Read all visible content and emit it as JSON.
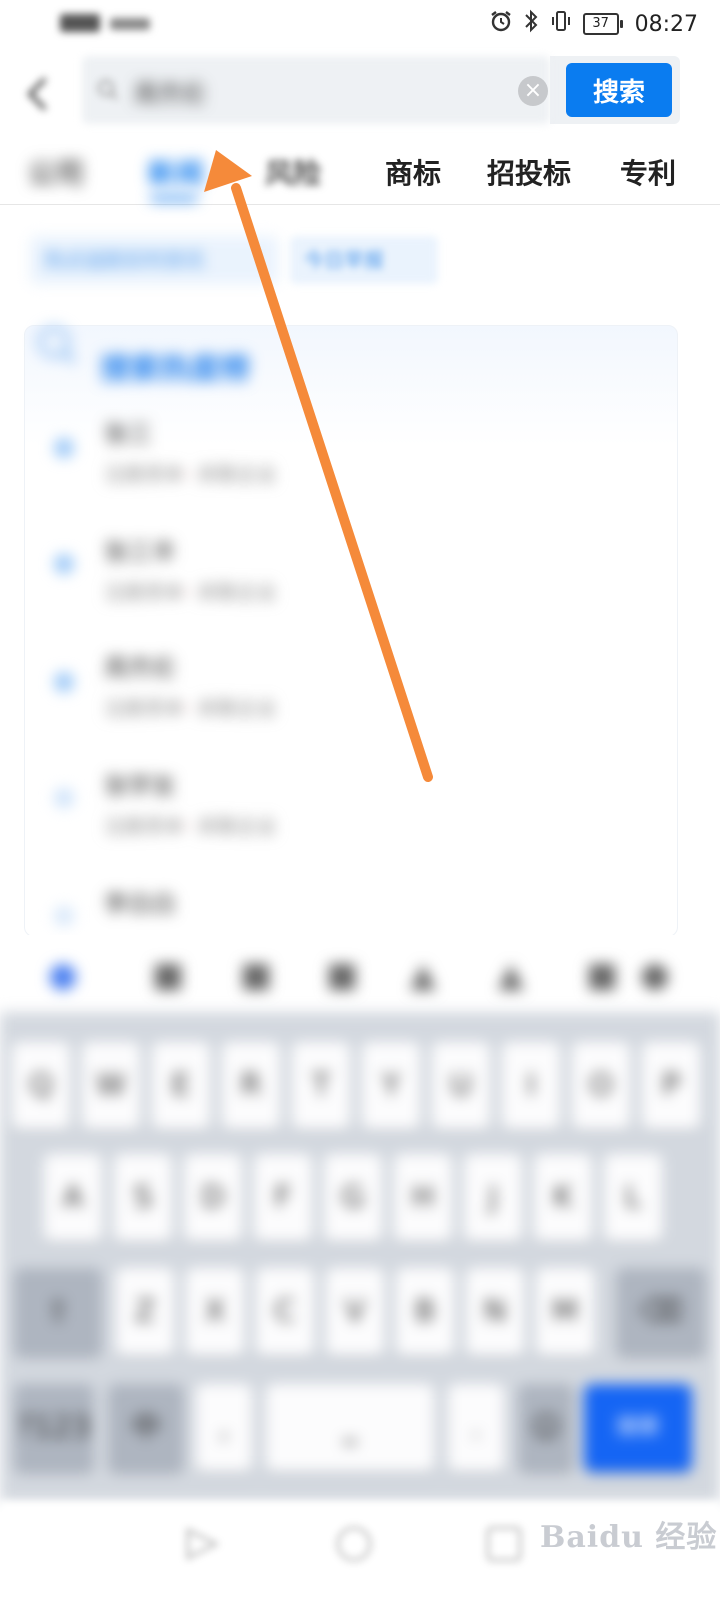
{
  "status_bar": {
    "battery": "37",
    "time": "08:27",
    "icons": [
      "alarm-icon",
      "bluetooth-icon",
      "vibrate-icon",
      "battery-icon"
    ]
  },
  "search": {
    "query": "周杰伦",
    "button_label": "搜索"
  },
  "tabs": [
    {
      "label": "公司",
      "active": false
    },
    {
      "label": "新闻",
      "active": true
    },
    {
      "label": "风险",
      "active": false
    },
    {
      "label": "商标",
      "active": false
    },
    {
      "label": "招投标",
      "active": false
    },
    {
      "label": "专利",
      "active": false
    }
  ],
  "chips": [
    "热点追踪实时资讯",
    "今日早报"
  ],
  "hot_search": {
    "title": "搜索热度榜",
    "items": [
      {
        "name": "张三",
        "meta_prefix": "注册资本",
        "meta_suffix": "关联企业"
      },
      {
        "name": "张三丰",
        "meta_prefix": "注册资本",
        "meta_suffix": "关联企业"
      },
      {
        "name": "周杰伦",
        "meta_prefix": "注册资本",
        "meta_suffix": "关联企业"
      },
      {
        "name": "张学友",
        "meta_prefix": "注册资本",
        "meta_suffix": "关联企业"
      },
      {
        "name": "李白白",
        "meta_prefix": "",
        "meta_suffix": ""
      }
    ]
  },
  "keyboard": {
    "row1": [
      "Q",
      "W",
      "E",
      "R",
      "T",
      "Y",
      "U",
      "I",
      "O",
      "P"
    ],
    "row2": [
      "A",
      "S",
      "D",
      "F",
      "G",
      "H",
      "J",
      "K",
      "L"
    ],
    "row3": [
      "Z",
      "X",
      "C",
      "V",
      "B",
      "N",
      "M"
    ],
    "enter_label": "搜索"
  },
  "watermark": "Baidu 经验",
  "colors": {
    "accent": "#0a7cf0",
    "arrow": "#f58a3a",
    "enter_key": "#1565f4"
  }
}
